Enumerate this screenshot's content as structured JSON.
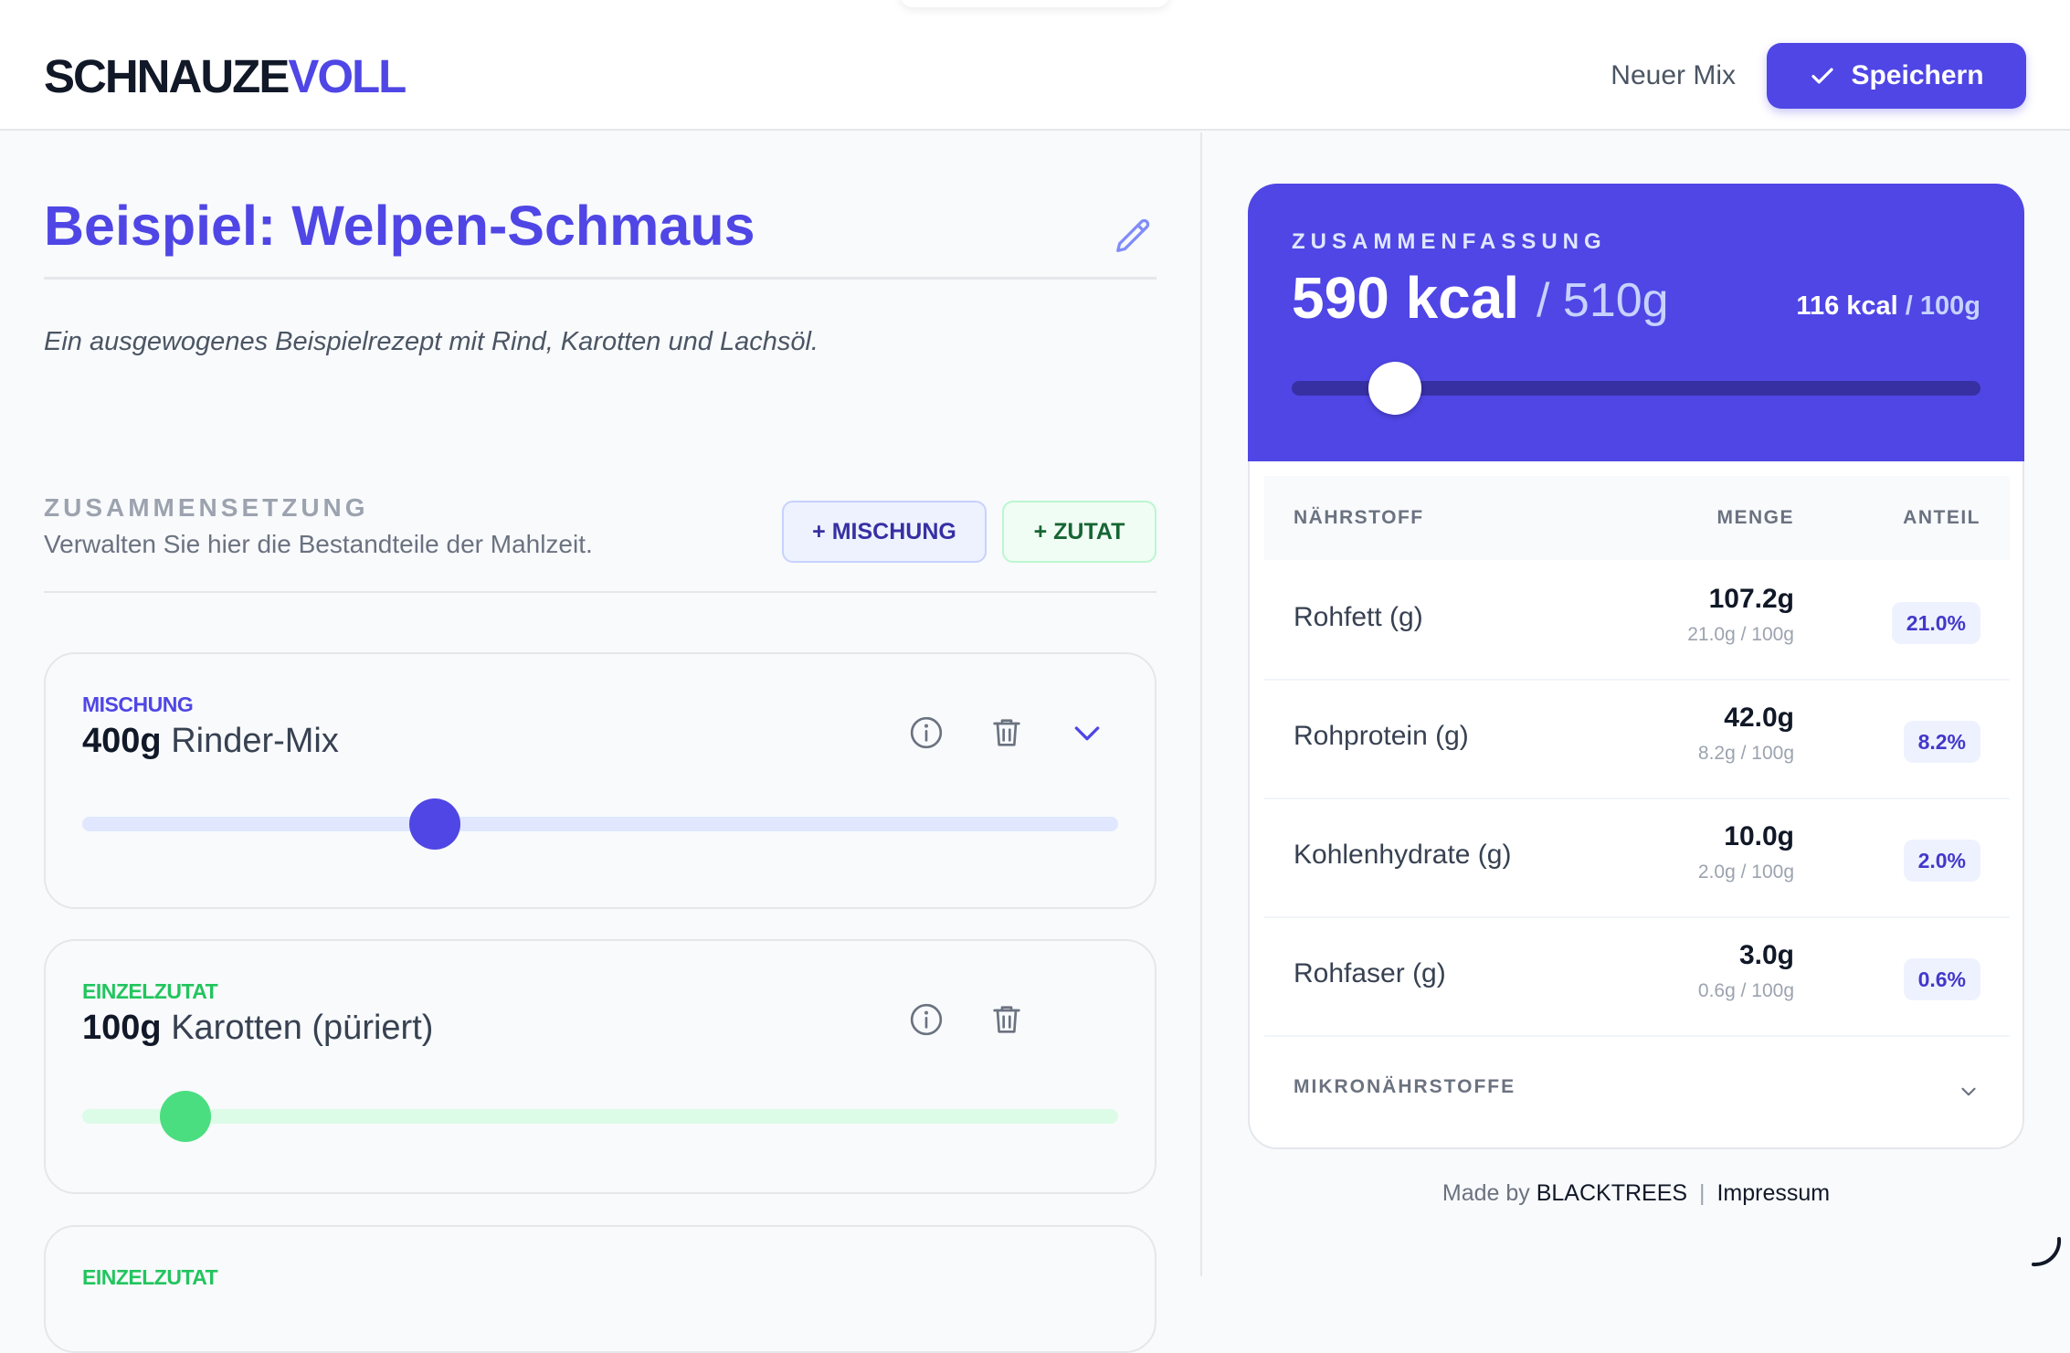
{
  "brand": {
    "part1": "SCHNAUZE",
    "part2": "VOLL"
  },
  "header": {
    "new_mix_label": "Neuer Mix",
    "save_label": "Speichern"
  },
  "recipe": {
    "title": "Beispiel: Welpen-Schmaus",
    "description": "Ein ausgewogenes Beispielrezept mit Rind, Karotten und Lachsöl."
  },
  "composition": {
    "label": "ZUSAMMENSETZUNG",
    "subtitle": "Verwalten Sie hier die Bestandteile der Mahlzeit.",
    "add_mix_label": "+ MISCHUNG",
    "add_ingredient_label": "+ ZUTAT"
  },
  "components": [
    {
      "type": "MISCHUNG",
      "amount": "400g",
      "name": "Rinder-Mix",
      "slider_fraction": 0.34,
      "color": "#4f46e5",
      "track_color": "#e0e7ff"
    },
    {
      "type": "EINZELZUTAT",
      "amount": "100g",
      "name": "Karotten (püriert)",
      "slider_fraction": 0.1,
      "color": "#4ade80",
      "track_color": "#dcfce7"
    },
    {
      "type": "EINZELZUTAT"
    }
  ],
  "summary": {
    "label": "ZUSAMMENFASSUNG",
    "kcal": "590 kcal",
    "weight": "/ 510g",
    "per100_value": "116 kcal",
    "per100_unit": "/ 100g",
    "slider_fraction": 0.15
  },
  "nutrients": {
    "headers": {
      "name": "NÄHRSTOFF",
      "amount": "MENGE",
      "share": "ANTEIL"
    },
    "rows": [
      {
        "name": "Rohfett (g)",
        "amount": "107.2g",
        "per100": "21.0g / 100g",
        "share": "21.0%"
      },
      {
        "name": "Rohprotein (g)",
        "amount": "42.0g",
        "per100": "8.2g / 100g",
        "share": "8.2%"
      },
      {
        "name": "Kohlenhydrate (g)",
        "amount": "10.0g",
        "per100": "2.0g / 100g",
        "share": "2.0%"
      },
      {
        "name": "Rohfaser (g)",
        "amount": "3.0g",
        "per100": "0.6g / 100g",
        "share": "0.6%"
      }
    ],
    "micro_label": "MIKRONÄHRSTOFFE"
  },
  "footer": {
    "made_by": "Made by",
    "company": "BLACKTREES",
    "separator": "|",
    "imprint": "Impressum"
  },
  "colors": {
    "accent": "#4f46e5",
    "green": "#4ade80",
    "green_text": "#22c55e"
  }
}
